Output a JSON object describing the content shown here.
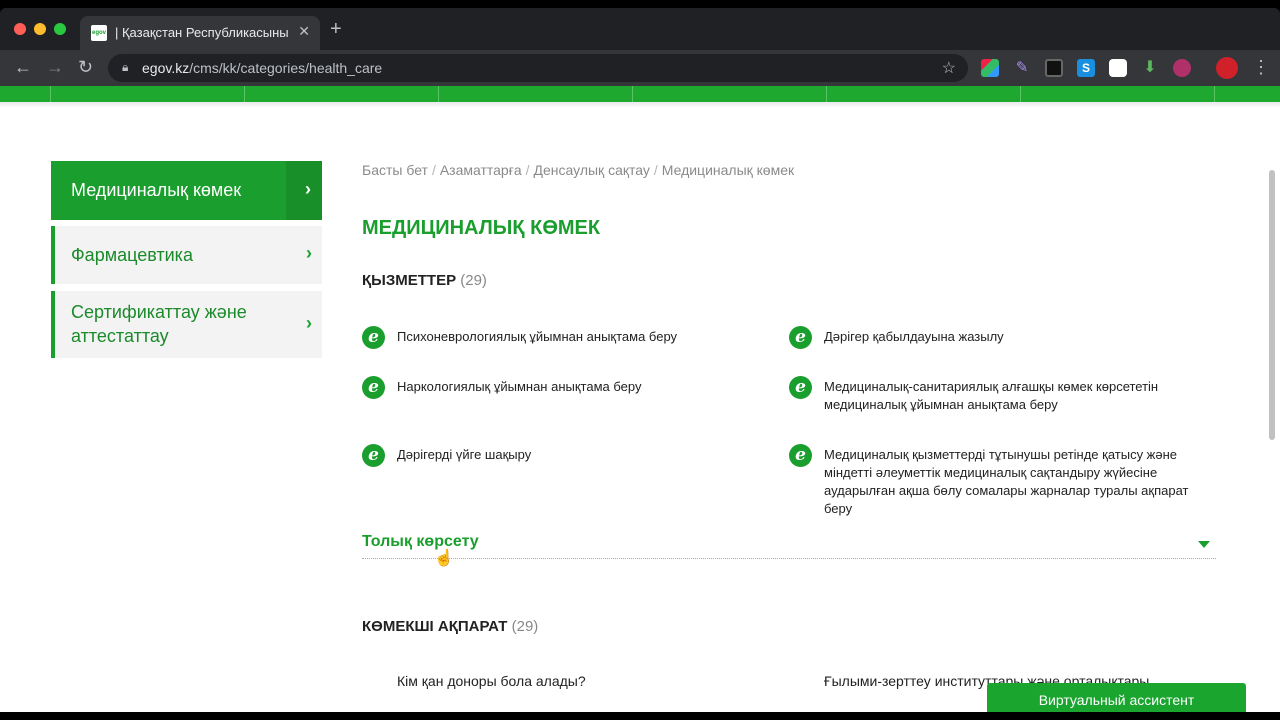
{
  "browser": {
    "tab_title": "| Қазақстан Республикасыны",
    "tab_favicon": "egov",
    "url_host": "egov.kz",
    "url_path": "/cms/kk/categories/health_care",
    "icons": [
      "back-icon",
      "forward-icon",
      "reload-icon",
      "lock-icon",
      "star-icon",
      "menu-icon"
    ]
  },
  "sidebar": {
    "items": [
      {
        "label": "Медициналық көмек",
        "active": true
      },
      {
        "label": "Фармацевтика",
        "active": false
      },
      {
        "label": "Сертификаттау және аттестаттау",
        "active": false
      }
    ]
  },
  "breadcrumb": {
    "items": [
      "Басты бет",
      "Азаматтарға",
      "Денсаулық сақтау",
      "Медициналық көмек"
    ],
    "separator": "/"
  },
  "page": {
    "title": "МЕДИЦИНАЛЫҚ КӨМЕК"
  },
  "services": {
    "title": "ҚЫЗМЕТТЕР",
    "count": "(29)",
    "icon_letter": "e",
    "items": [
      "Психоневрологиялық ұйымнан анықтама беру",
      "Дәрігер қабылдауына жазылу",
      "Наркологиялық ұйымнан анықтама беру",
      "Медициналық-санитариялық алғашқы көмек көрсететін медициналық ұйымнан анықтама беру",
      "Дәрігерді үйге шақыру",
      "Медициналық қызметтерді тұтынушы ретінде қатысу және міндетті әлеуметтік медициналық сақтандыру жүйесіне аударылған ақша бөлу сомалары жарналар туралы ақпарат беру"
    ],
    "show_more_label": "Толық көрсету"
  },
  "info": {
    "title": "КӨМЕКШІ АҚПАРАТ",
    "count": "(29)",
    "items": [
      "Кім қан доноры бола алады?",
      "Ғылыми-зерттеу институттары және орталықтары"
    ]
  },
  "assistant": {
    "label": "Виртуальный ассистент"
  },
  "colors": {
    "accent": "#1a9e2e",
    "accent_dark": "#188f29",
    "nav_green": "#1fa82f"
  }
}
